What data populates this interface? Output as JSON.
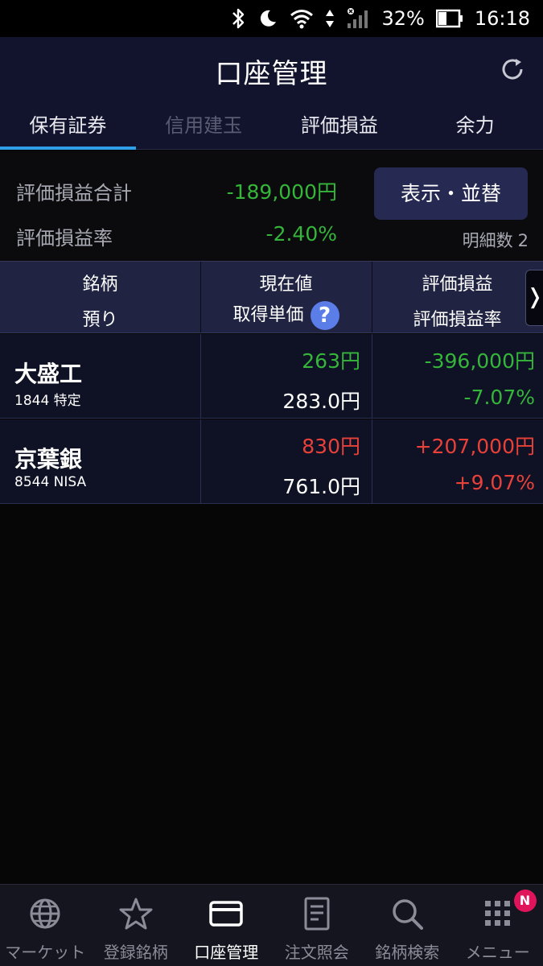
{
  "status_bar": {
    "battery": "32%",
    "time": "16:18"
  },
  "header": {
    "title": "口座管理"
  },
  "tabs": [
    {
      "label": "保有証券",
      "state": "active"
    },
    {
      "label": "信用建玉",
      "state": "disabled"
    },
    {
      "label": "評価損益",
      "state": "normal"
    },
    {
      "label": "余力",
      "state": "normal"
    }
  ],
  "summary": {
    "total_label": "評価損益合計",
    "total_value": "-189,000円",
    "rate_label": "評価損益率",
    "rate_value": "-2.40%",
    "display_button": "表示・並替",
    "count_label": "明細数",
    "count_value": "2"
  },
  "table": {
    "headers": {
      "col1_top": "銘柄",
      "col1_bottom": "預り",
      "col2_top": "現在値",
      "col2_bottom": "取得単価",
      "col3_top": "評価損益",
      "col3_bottom": "評価損益率"
    },
    "help_icon": "?",
    "scroll_arrow": "❭",
    "rows": [
      {
        "name": "大盛工",
        "sub": "1844 特定",
        "price": "263円",
        "cost": "283.0円",
        "pl": "-396,000円",
        "pl_rate": "-7.07%",
        "trend": "down"
      },
      {
        "name": "京葉銀",
        "sub": "8544 NISA",
        "price": "830円",
        "cost": "761.0円",
        "pl": "+207,000円",
        "pl_rate": "+9.07%",
        "trend": "up"
      }
    ]
  },
  "bottom_nav": [
    {
      "label": "マーケット",
      "icon": "globe-icon"
    },
    {
      "label": "登録銘柄",
      "icon": "star-icon"
    },
    {
      "label": "口座管理",
      "icon": "card-icon",
      "active": true
    },
    {
      "label": "注文照会",
      "icon": "document-icon"
    },
    {
      "label": "銘柄検索",
      "icon": "search-icon"
    },
    {
      "label": "メニュー",
      "icon": "grid-menu-icon",
      "badge": "N"
    }
  ],
  "colors": {
    "gain": "#e8413a",
    "loss": "#35b53a",
    "accent": "#2f9fe8",
    "header_bg": "#12142e"
  }
}
